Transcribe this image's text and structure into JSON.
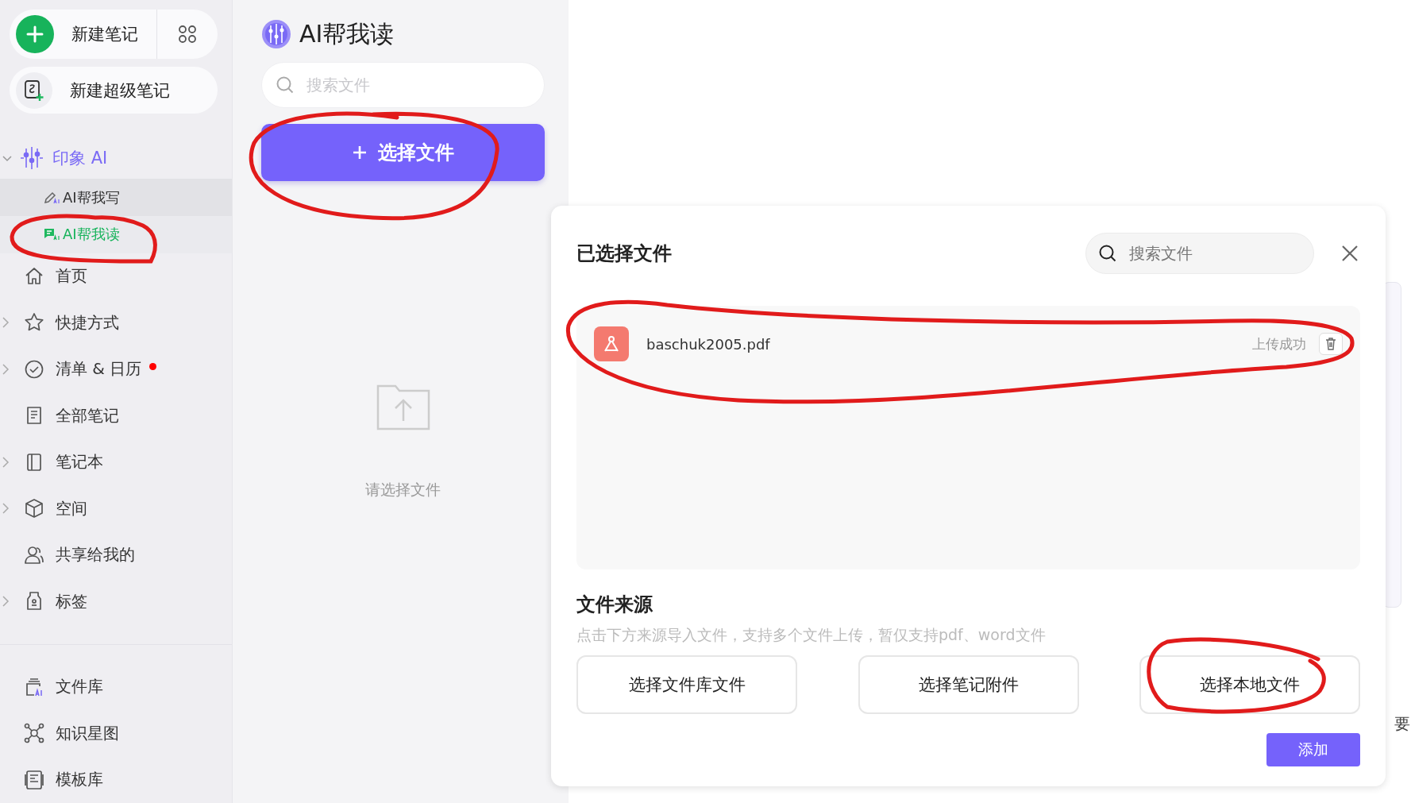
{
  "sidebar": {
    "new_note": {
      "label": "新建笔记"
    },
    "new_super_note": {
      "label": "新建超级笔记"
    },
    "ai_section": {
      "label": "印象 AI",
      "expanded": true,
      "children": [
        {
          "label": "AI帮我写",
          "selected": false
        },
        {
          "label": "AI帮我读",
          "selected": true
        }
      ]
    },
    "items": [
      {
        "label": "首页",
        "has_children": false,
        "dot": false
      },
      {
        "label": "快捷方式",
        "has_children": true,
        "dot": false
      },
      {
        "label": "清单 & 日历",
        "has_children": true,
        "dot": true
      },
      {
        "label": "全部笔记",
        "has_children": false,
        "dot": false
      },
      {
        "label": "笔记本",
        "has_children": true,
        "dot": false
      },
      {
        "label": "空间",
        "has_children": true,
        "dot": false
      },
      {
        "label": "共享给我的",
        "has_children": false,
        "dot": false
      },
      {
        "label": "标签",
        "has_children": true,
        "dot": false
      }
    ],
    "bottom_items": [
      {
        "label": "文件库"
      },
      {
        "label": "知识星图"
      },
      {
        "label": "模板库"
      }
    ]
  },
  "reader_panel": {
    "title": "AI帮我读",
    "search": {
      "placeholder": "搜索文件"
    },
    "select_button": "选择文件",
    "empty_text": "请选择文件"
  },
  "dialog": {
    "title": "已选择文件",
    "search": {
      "placeholder": "搜索文件"
    },
    "files": [
      {
        "name": "baschuk2005.pdf",
        "status": "上传成功"
      }
    ],
    "source_title": "文件来源",
    "source_hint": "点击下方来源导入文件，支持多个文件上传，暂仅支持pdf、word文件",
    "source_buttons": [
      "选择文件库文件",
      "选择笔记附件",
      "选择本地文件"
    ],
    "add_button": "添加"
  },
  "background_text": "要"
}
